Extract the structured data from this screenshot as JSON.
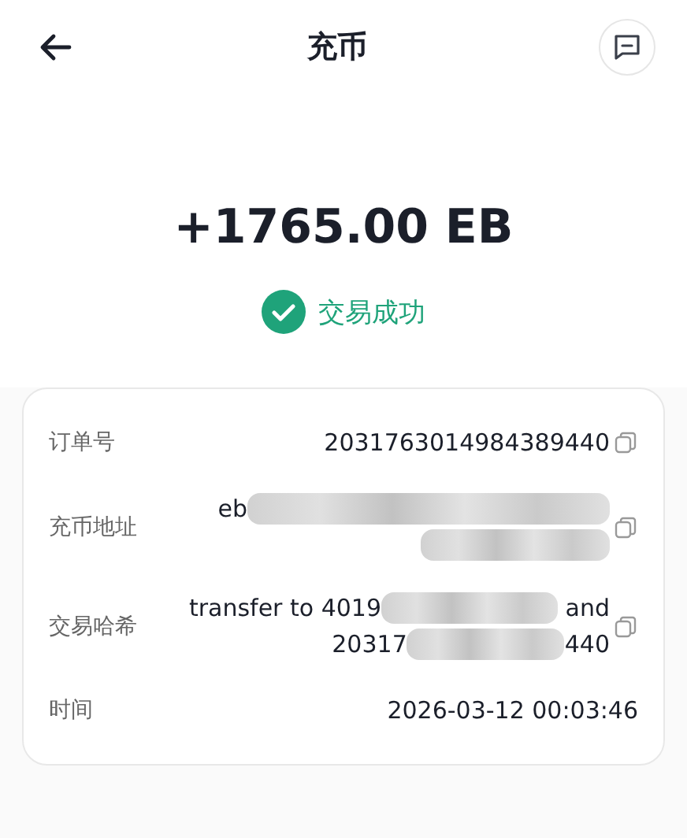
{
  "header": {
    "title": "充币"
  },
  "amount": "+1765.00 EB",
  "status": {
    "label": "交易成功",
    "success": true
  },
  "details": [
    {
      "label": "订单号",
      "copyable": true,
      "lines": [
        [
          {
            "kind": "text",
            "text": "2031763014984389440"
          }
        ]
      ]
    },
    {
      "label": "充币地址",
      "copyable": true,
      "lines": [
        [
          {
            "kind": "text",
            "text": "eb"
          },
          {
            "kind": "redacted"
          }
        ],
        [
          {
            "kind": "redacted"
          }
        ]
      ]
    },
    {
      "label": "交易哈希",
      "copyable": true,
      "lines": [
        [
          {
            "kind": "text",
            "text": "transfer to 4019"
          },
          {
            "kind": "redacted"
          },
          {
            "kind": "text",
            "text": " and"
          }
        ],
        [
          {
            "kind": "text",
            "text": "20317"
          },
          {
            "kind": "redacted"
          },
          {
            "kind": "text",
            "text": "440"
          }
        ]
      ]
    },
    {
      "label": "时间",
      "copyable": false,
      "lines": [
        [
          {
            "kind": "text",
            "text": "2026-03-12 00:03:46"
          }
        ]
      ]
    }
  ]
}
